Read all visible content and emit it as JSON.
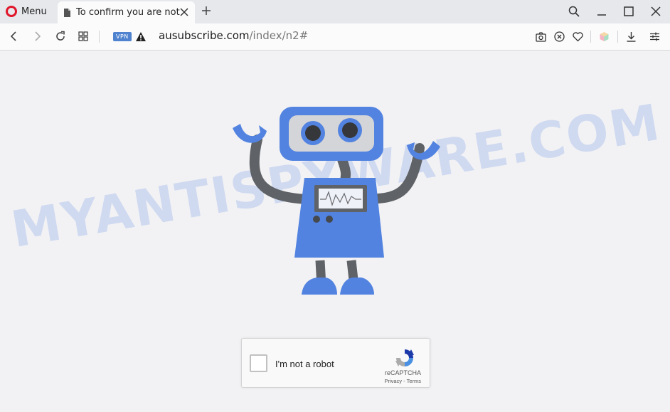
{
  "browser": {
    "menu_label": "Menu",
    "tab_title": "To confirm you are not a robot",
    "vpn_badge": "VPN",
    "url_domain": "ausubscribe.com",
    "url_path": "/index/n2#"
  },
  "page": {
    "watermark": "MYANTISPYWARE.COM",
    "captcha": {
      "label": "I'm not a robot",
      "brand": "reCAPTCHA",
      "links": "Privacy - Terms"
    }
  },
  "colors": {
    "accent": "#4f83cf",
    "robot_blue": "#5283e0",
    "opera_red": "#e0162b"
  }
}
